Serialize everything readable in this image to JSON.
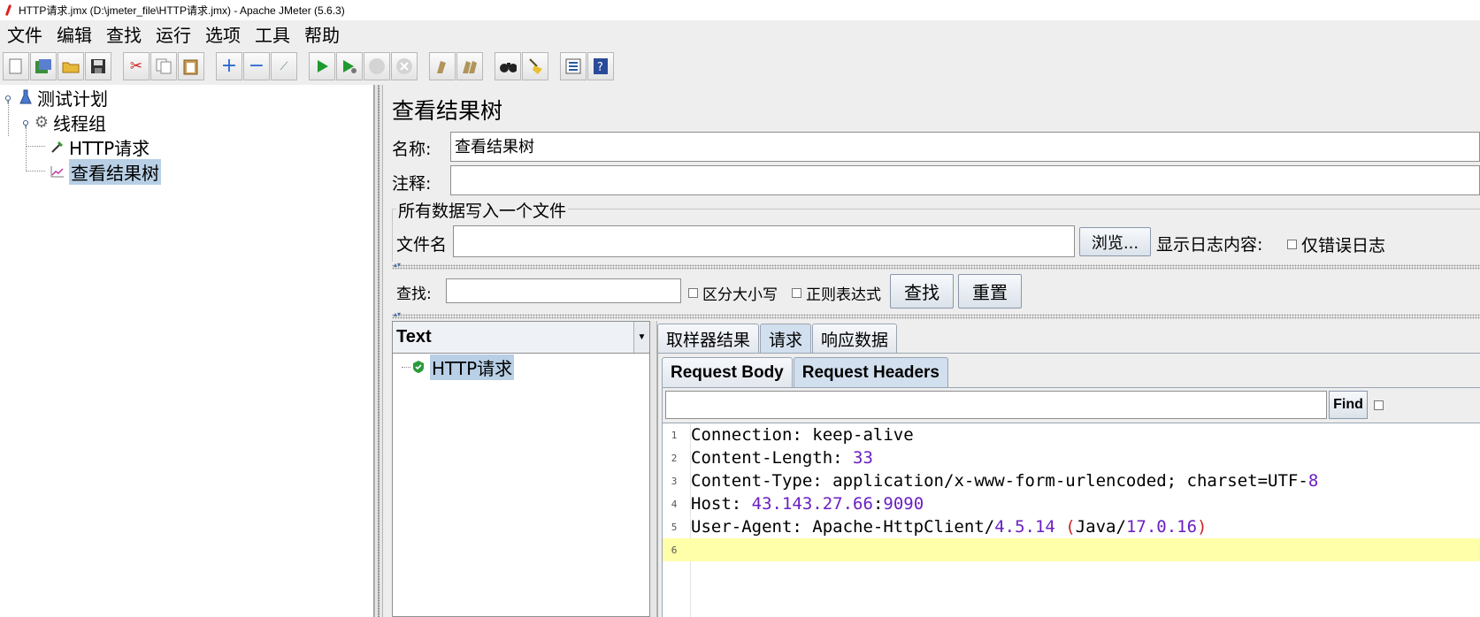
{
  "window": {
    "title": "HTTP请求.jmx (D:\\jmeter_file\\HTTP请求.jmx) - Apache JMeter (5.6.3)"
  },
  "menu": [
    "文件",
    "编辑",
    "查找",
    "运行",
    "选项",
    "工具",
    "帮助"
  ],
  "toolbar_icons": [
    "new-icon",
    "templates-icon",
    "open-icon",
    "save-icon",
    "cut-icon",
    "copy-icon",
    "paste-icon",
    "expand-icon",
    "collapse-icon",
    "toggle-icon",
    "start-icon",
    "start-no-pause-icon",
    "stop-icon",
    "shutdown-icon",
    "clear-icon",
    "clear-all-icon",
    "search-icon",
    "reset-search-icon",
    "function-helper-icon",
    "help-icon"
  ],
  "tree": {
    "test_plan": "测试计划",
    "thread_group": "线程组",
    "http_request": "HTTP请求",
    "view_results_tree": "查看结果树"
  },
  "panel": {
    "title": "查看结果树",
    "name_label": "名称:",
    "name_value": "查看结果树",
    "comment_label": "注释:",
    "comment_value": "",
    "file_group_title": "所有数据写入一个文件",
    "filename_label": "文件名",
    "filename_value": "",
    "browse_button": "浏览...",
    "log_label": "显示日志内容:",
    "errors_only_label": "仅错误日志"
  },
  "search": {
    "label": "查找:",
    "value": "",
    "case_sensitive_label": "区分大小写",
    "regex_label": "正则表达式",
    "find_button": "查找",
    "reset_button": "重置"
  },
  "results": {
    "renderer": "Text",
    "samples": [
      {
        "label": "HTTP请求",
        "status": "success"
      }
    ],
    "tabs": [
      "取样器结果",
      "请求",
      "响应数据"
    ],
    "active_tab": "请求",
    "subtabs": [
      "Request Body",
      "Request Headers"
    ],
    "active_subtab": "Request Headers",
    "find_button": "Find",
    "find_value": "",
    "lines": [
      {
        "num": "1",
        "key": "Connection",
        "sep": ": ",
        "value": "keep-alive"
      },
      {
        "num": "2",
        "key": "Content-Length",
        "sep": ": ",
        "value": "33"
      },
      {
        "num": "3",
        "key": "Content-Type",
        "sep": ": ",
        "value": "application/x-www-form-urlencoded; charset=UTF-8"
      },
      {
        "num": "4",
        "key": "Host",
        "sep": ": ",
        "value": "43.143.27.66:9090"
      },
      {
        "num": "5",
        "key": "User-Agent",
        "sep": ": ",
        "value": "Apache-HttpClient/4.5.14 (Java/17.0.16)"
      },
      {
        "num": "6",
        "key": "",
        "sep": "",
        "value": ""
      }
    ]
  },
  "colors": {
    "selection": "#b8cfe5",
    "current_line": "#ffffaa",
    "number_token": "#6a1fc2",
    "paren_token": "#cc2222"
  }
}
